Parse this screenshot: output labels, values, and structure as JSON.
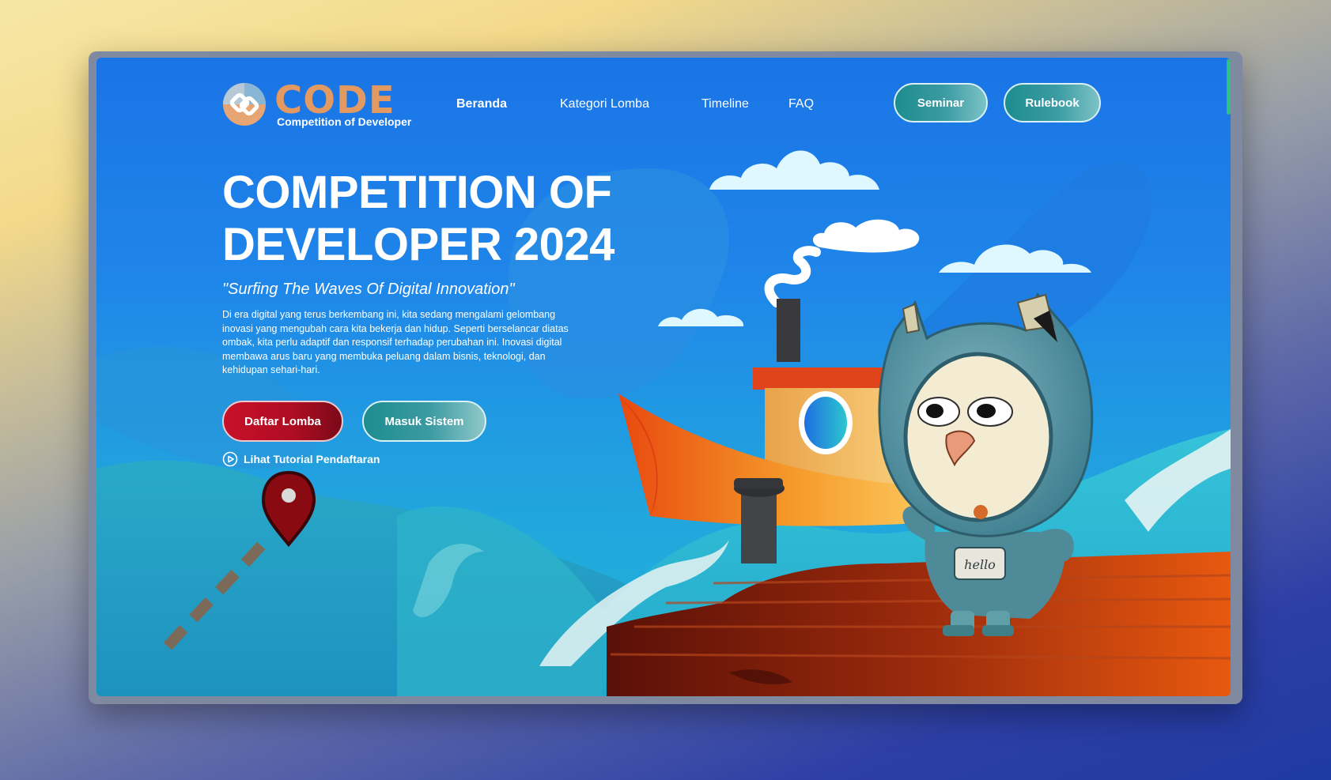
{
  "brand": {
    "logo_title": "CODE",
    "logo_subtitle": "Competition of Developer"
  },
  "nav": {
    "links": [
      {
        "label": "Beranda",
        "active": true
      },
      {
        "label": "Kategori Lomba",
        "active": false
      },
      {
        "label": "Timeline",
        "active": false
      },
      {
        "label": "FAQ",
        "active": false
      }
    ],
    "seminar_label": "Seminar",
    "rulebook_label": "Rulebook"
  },
  "hero": {
    "title": "COMPETITION OF DEVELOPER 2024",
    "tagline": "\"Surfing The Waves Of Digital Innovation\"",
    "description": "Di era digital yang terus berkembang ini, kita sedang mengalami gelombang inovasi yang mengubah cara kita bekerja dan hidup. Seperti berselancar diatas ombak, kita perlu adaptif dan responsif terhadap perubahan ini. Inovasi digital membawa arus baru yang membuka peluang dalam bisnis, teknologi, dan kehidupan sehari-hari.",
    "register_label": "Daftar Lomba",
    "login_label": "Masuk Sistem",
    "tutorial_label": "Lihat Tutorial Pendaftaran"
  },
  "illustration": {
    "mascot_badge_text": "hello"
  },
  "colors": {
    "sky_top": "#1a74e6",
    "sky_bottom": "#20b8d7",
    "teal_button": "#1d8d8f",
    "red_button": "#c9102a",
    "logo_orange": "#e39a62"
  },
  "icons": {
    "logo": "code-logo-icon",
    "tutorial": "play-circle-icon",
    "location": "location-pin-icon"
  }
}
